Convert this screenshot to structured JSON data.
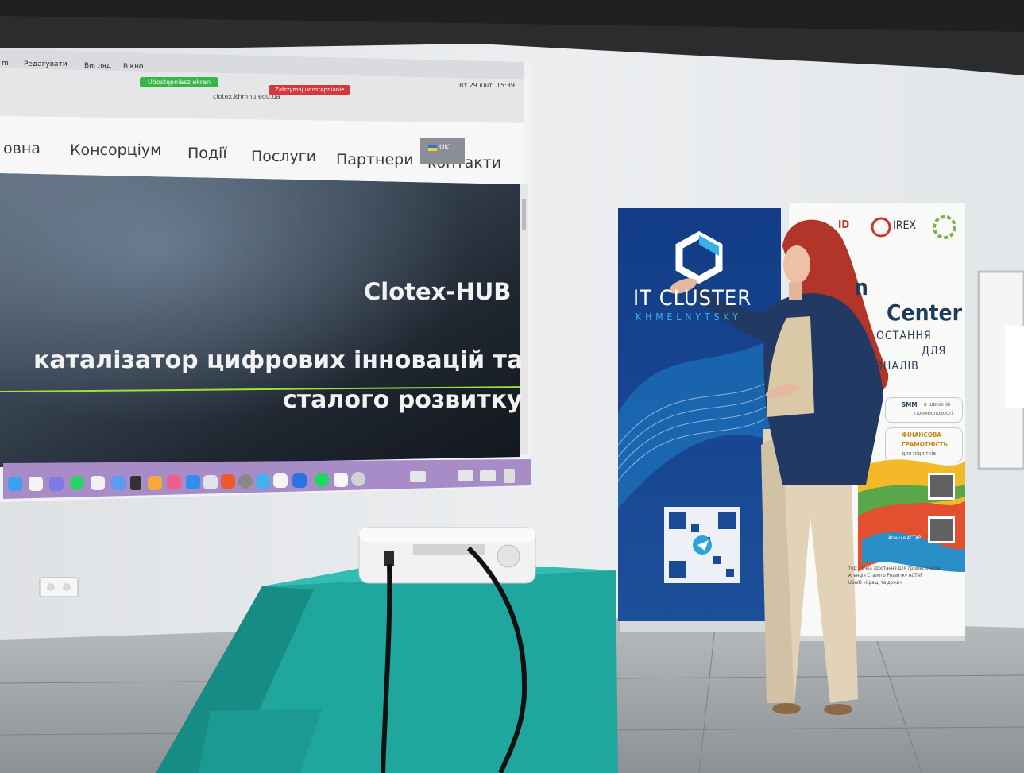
{
  "macos": {
    "menu": [
      "m",
      "Редагувати",
      "Вигляд",
      "Вікно"
    ],
    "share_label": "Udostępniasz ekran",
    "stop_label": "Zatrzymaj udostępnianie",
    "clock": "Вт 29 квіт. 15:39",
    "url": "clotex.khmnu.edu.ua"
  },
  "website": {
    "nav": [
      "овна",
      "Консорціум",
      "Події",
      "Послуги",
      "Партнери",
      "контакти"
    ],
    "lang": "UK",
    "hero_title": "Clotex-HUB",
    "hero_line1": "каталізатор цифрових інновацій та",
    "hero_line2": "сталого розвитку"
  },
  "banner_itc": {
    "title": "IT CLUSTER",
    "subtitle": "KHMELNYTSKY"
  },
  "banner_irex": {
    "logo_usaid": "ID",
    "logo_irex": "IREX",
    "heading1": "n",
    "heading2": "Center",
    "sub1": "ОСТАННЯ",
    "sub2": "ДЛЯ",
    "sub3": "ОНАЛІВ",
    "card1_a": "SMM",
    "card1_b": "в швейній",
    "card1_c": "промисловості",
    "card2_a": "ФІНАНСОВА",
    "card2_b": "ГРАМОТНІСТЬ",
    "card2_c": "для підлітків",
    "footer_label": "Агенція АСТАР",
    "fine_print_1": "тер: точка зростання для професіоналів",
    "fine_print_2": "Агенція Сталого Розвитку АСТАР",
    "fine_print_3": "USAID «Кращі та дожи»"
  },
  "colors": {
    "wall": "#e9ecef",
    "ceiling": "#2a2b2c",
    "floor": "#9a9ea1",
    "banner_blue": "#1a4a93",
    "podium_teal": "#1fa79e",
    "jacket": "#223a63",
    "hair": "#b2352a",
    "trousers": "#e2d3b8"
  }
}
